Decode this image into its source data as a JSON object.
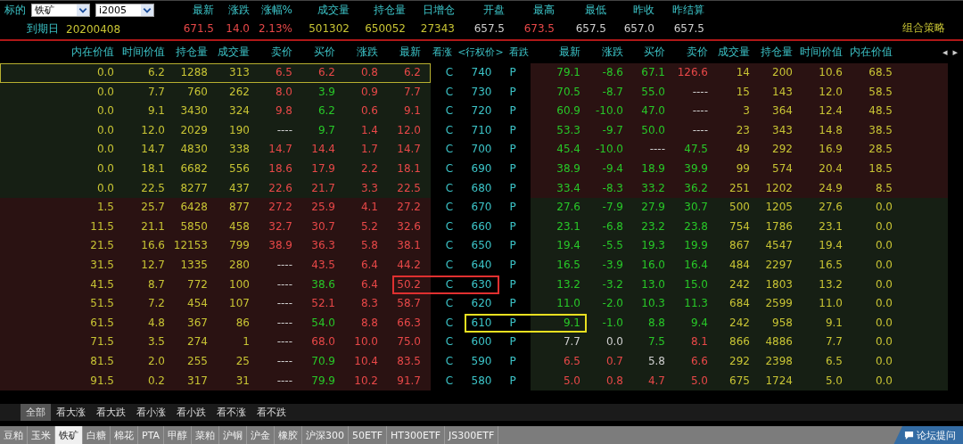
{
  "underlying": {
    "label": "标的",
    "product": "铁矿",
    "contract": "i2005"
  },
  "expiry": {
    "label": "到期日",
    "value": "20200408"
  },
  "stats": [
    {
      "label": "最新",
      "value": "671.5",
      "color": "#e84848"
    },
    {
      "label": "涨跌",
      "value": "14.0",
      "color": "#e84848"
    },
    {
      "label": "涨幅%",
      "value": "2.13%",
      "color": "#e84848"
    },
    {
      "label": "成交量",
      "value": "501302",
      "color": "#c8c434"
    },
    {
      "label": "持仓量",
      "value": "650052",
      "color": "#c8c434"
    },
    {
      "label": "日增仓",
      "value": "27343",
      "color": "#c8c434"
    },
    {
      "label": "开盘",
      "value": "657.5",
      "color": "#cfcfcf"
    },
    {
      "label": "最高",
      "value": "673.5",
      "color": "#e84848"
    },
    {
      "label": "最低",
      "value": "657.5",
      "color": "#cfcfcf"
    },
    {
      "label": "昨收",
      "value": "657.0",
      "color": "#cfcfcf"
    },
    {
      "label": "昨结算",
      "value": "657.5",
      "color": "#cfcfcf"
    }
  ],
  "strategy_link": "组合策略",
  "columns": {
    "call": [
      "内在价值",
      "时间价值",
      "持仓量",
      "成交量",
      "卖价",
      "买价",
      "涨跌",
      "最新"
    ],
    "middle": [
      "看涨",
      "<行权价>",
      "看跌"
    ],
    "put": [
      "最新",
      "涨跌",
      "买价",
      "卖价",
      "成交量",
      "持仓量",
      "时间价值",
      "内在价值"
    ],
    "scroll_arrows": [
      "◂",
      "▸"
    ]
  },
  "rows": [
    {
      "selected": true,
      "call_itm": false,
      "put_itm": true,
      "call_stats": [
        "0.0",
        "6.2",
        "1288",
        "313"
      ],
      "call_quotes": [
        {
          "text": "6.5",
          "color": "#e84848"
        },
        {
          "text": "6.2",
          "color": "#e84848"
        },
        {
          "text": "0.8",
          "color": "#e84848"
        },
        {
          "text": "6.2",
          "color": "#e84848"
        }
      ],
      "c": "C",
      "strike": "740",
      "p": "P",
      "put_quotes": [
        {
          "text": "79.1",
          "color": "#28c828"
        },
        {
          "text": "-8.6",
          "color": "#28c828"
        },
        {
          "text": "67.1",
          "color": "#28c828"
        },
        {
          "text": "126.6",
          "color": "#e84848"
        }
      ],
      "put_stats": [
        "14",
        "200",
        "10.6",
        "68.5"
      ]
    },
    {
      "selected": false,
      "call_itm": false,
      "put_itm": true,
      "call_stats": [
        "0.0",
        "7.7",
        "760",
        "262"
      ],
      "call_quotes": [
        {
          "text": "8.0",
          "color": "#e84848"
        },
        {
          "text": "3.9",
          "color": "#28c828"
        },
        {
          "text": "0.9",
          "color": "#e84848"
        },
        {
          "text": "7.7",
          "color": "#e84848"
        }
      ],
      "c": "C",
      "strike": "730",
      "p": "P",
      "put_quotes": [
        {
          "text": "70.5",
          "color": "#28c828"
        },
        {
          "text": "-8.7",
          "color": "#28c828"
        },
        {
          "text": "55.0",
          "color": "#28c828"
        },
        {
          "text": "----",
          "color": "#cfcfcf"
        }
      ],
      "put_stats": [
        "15",
        "143",
        "12.0",
        "58.5"
      ]
    },
    {
      "selected": false,
      "call_itm": false,
      "put_itm": true,
      "call_stats": [
        "0.0",
        "9.1",
        "3430",
        "324"
      ],
      "call_quotes": [
        {
          "text": "9.8",
          "color": "#e84848"
        },
        {
          "text": "6.2",
          "color": "#28c828"
        },
        {
          "text": "0.6",
          "color": "#e84848"
        },
        {
          "text": "9.1",
          "color": "#e84848"
        }
      ],
      "c": "C",
      "strike": "720",
      "p": "P",
      "put_quotes": [
        {
          "text": "60.9",
          "color": "#28c828"
        },
        {
          "text": "-10.0",
          "color": "#28c828"
        },
        {
          "text": "47.0",
          "color": "#28c828"
        },
        {
          "text": "----",
          "color": "#cfcfcf"
        }
      ],
      "put_stats": [
        "3",
        "364",
        "12.4",
        "48.5"
      ]
    },
    {
      "selected": false,
      "call_itm": false,
      "put_itm": true,
      "call_stats": [
        "0.0",
        "12.0",
        "2029",
        "190"
      ],
      "call_quotes": [
        {
          "text": "----",
          "color": "#cfcfcf"
        },
        {
          "text": "9.7",
          "color": "#28c828"
        },
        {
          "text": "1.4",
          "color": "#e84848"
        },
        {
          "text": "12.0",
          "color": "#e84848"
        }
      ],
      "c": "C",
      "strike": "710",
      "p": "P",
      "put_quotes": [
        {
          "text": "53.3",
          "color": "#28c828"
        },
        {
          "text": "-9.7",
          "color": "#28c828"
        },
        {
          "text": "50.0",
          "color": "#28c828"
        },
        {
          "text": "----",
          "color": "#cfcfcf"
        }
      ],
      "put_stats": [
        "23",
        "343",
        "14.8",
        "38.5"
      ]
    },
    {
      "selected": false,
      "call_itm": false,
      "put_itm": true,
      "call_stats": [
        "0.0",
        "14.7",
        "4830",
        "338"
      ],
      "call_quotes": [
        {
          "text": "14.7",
          "color": "#e84848"
        },
        {
          "text": "14.4",
          "color": "#e84848"
        },
        {
          "text": "1.7",
          "color": "#e84848"
        },
        {
          "text": "14.7",
          "color": "#e84848"
        }
      ],
      "c": "C",
      "strike": "700",
      "p": "P",
      "put_quotes": [
        {
          "text": "45.4",
          "color": "#28c828"
        },
        {
          "text": "-10.0",
          "color": "#28c828"
        },
        {
          "text": "----",
          "color": "#cfcfcf"
        },
        {
          "text": "47.5",
          "color": "#28c828"
        }
      ],
      "put_stats": [
        "49",
        "292",
        "16.9",
        "28.5"
      ]
    },
    {
      "selected": false,
      "call_itm": false,
      "put_itm": true,
      "call_stats": [
        "0.0",
        "18.1",
        "6682",
        "556"
      ],
      "call_quotes": [
        {
          "text": "18.6",
          "color": "#e84848"
        },
        {
          "text": "17.9",
          "color": "#e84848"
        },
        {
          "text": "2.2",
          "color": "#e84848"
        },
        {
          "text": "18.1",
          "color": "#e84848"
        }
      ],
      "c": "C",
      "strike": "690",
      "p": "P",
      "put_quotes": [
        {
          "text": "38.9",
          "color": "#28c828"
        },
        {
          "text": "-9.4",
          "color": "#28c828"
        },
        {
          "text": "18.9",
          "color": "#28c828"
        },
        {
          "text": "39.9",
          "color": "#28c828"
        }
      ],
      "put_stats": [
        "99",
        "574",
        "20.4",
        "18.5"
      ]
    },
    {
      "selected": false,
      "call_itm": false,
      "put_itm": true,
      "call_stats": [
        "0.0",
        "22.5",
        "8277",
        "437"
      ],
      "call_quotes": [
        {
          "text": "22.6",
          "color": "#e84848"
        },
        {
          "text": "21.7",
          "color": "#e84848"
        },
        {
          "text": "3.3",
          "color": "#e84848"
        },
        {
          "text": "22.5",
          "color": "#e84848"
        }
      ],
      "c": "C",
      "strike": "680",
      "p": "P",
      "put_quotes": [
        {
          "text": "33.4",
          "color": "#28c828"
        },
        {
          "text": "-8.3",
          "color": "#28c828"
        },
        {
          "text": "33.2",
          "color": "#28c828"
        },
        {
          "text": "36.2",
          "color": "#28c828"
        }
      ],
      "put_stats": [
        "251",
        "1202",
        "24.9",
        "8.5"
      ]
    },
    {
      "selected": false,
      "call_itm": true,
      "put_itm": false,
      "call_stats": [
        "1.5",
        "25.7",
        "6428",
        "877"
      ],
      "call_quotes": [
        {
          "text": "27.2",
          "color": "#e84848"
        },
        {
          "text": "25.9",
          "color": "#e84848"
        },
        {
          "text": "4.1",
          "color": "#e84848"
        },
        {
          "text": "27.2",
          "color": "#e84848"
        }
      ],
      "c": "C",
      "strike": "670",
      "p": "P",
      "put_quotes": [
        {
          "text": "27.6",
          "color": "#28c828"
        },
        {
          "text": "-7.9",
          "color": "#28c828"
        },
        {
          "text": "27.9",
          "color": "#28c828"
        },
        {
          "text": "30.7",
          "color": "#28c828"
        }
      ],
      "put_stats": [
        "500",
        "1205",
        "27.6",
        "0.0"
      ]
    },
    {
      "selected": false,
      "call_itm": true,
      "put_itm": false,
      "call_stats": [
        "11.5",
        "21.1",
        "5850",
        "458"
      ],
      "call_quotes": [
        {
          "text": "32.7",
          "color": "#e84848"
        },
        {
          "text": "30.7",
          "color": "#e84848"
        },
        {
          "text": "5.2",
          "color": "#e84848"
        },
        {
          "text": "32.6",
          "color": "#e84848"
        }
      ],
      "c": "C",
      "strike": "660",
      "p": "P",
      "put_quotes": [
        {
          "text": "23.1",
          "color": "#28c828"
        },
        {
          "text": "-6.8",
          "color": "#28c828"
        },
        {
          "text": "23.2",
          "color": "#28c828"
        },
        {
          "text": "23.8",
          "color": "#28c828"
        }
      ],
      "put_stats": [
        "754",
        "1786",
        "23.1",
        "0.0"
      ]
    },
    {
      "selected": false,
      "call_itm": true,
      "put_itm": false,
      "call_stats": [
        "21.5",
        "16.6",
        "12153",
        "799"
      ],
      "call_quotes": [
        {
          "text": "38.9",
          "color": "#e84848"
        },
        {
          "text": "36.3",
          "color": "#e84848"
        },
        {
          "text": "5.8",
          "color": "#e84848"
        },
        {
          "text": "38.1",
          "color": "#e84848"
        }
      ],
      "c": "C",
      "strike": "650",
      "p": "P",
      "put_quotes": [
        {
          "text": "19.4",
          "color": "#28c828"
        },
        {
          "text": "-5.5",
          "color": "#28c828"
        },
        {
          "text": "19.3",
          "color": "#28c828"
        },
        {
          "text": "19.9",
          "color": "#28c828"
        }
      ],
      "put_stats": [
        "867",
        "4547",
        "19.4",
        "0.0"
      ]
    },
    {
      "selected": false,
      "call_itm": true,
      "put_itm": false,
      "call_stats": [
        "31.5",
        "12.7",
        "1335",
        "280"
      ],
      "call_quotes": [
        {
          "text": "----",
          "color": "#cfcfcf"
        },
        {
          "text": "43.5",
          "color": "#e84848"
        },
        {
          "text": "6.4",
          "color": "#e84848"
        },
        {
          "text": "44.2",
          "color": "#e84848"
        }
      ],
      "c": "C",
      "strike": "640",
      "p": "P",
      "put_quotes": [
        {
          "text": "16.5",
          "color": "#28c828"
        },
        {
          "text": "-3.9",
          "color": "#28c828"
        },
        {
          "text": "16.0",
          "color": "#28c828"
        },
        {
          "text": "16.4",
          "color": "#28c828"
        }
      ],
      "put_stats": [
        "484",
        "2297",
        "16.5",
        "0.0"
      ]
    },
    {
      "selected": false,
      "call_itm": true,
      "put_itm": false,
      "box": {
        "kind": "call",
        "color": "#e03030"
      },
      "call_stats": [
        "41.5",
        "8.7",
        "772",
        "100"
      ],
      "call_quotes": [
        {
          "text": "----",
          "color": "#cfcfcf"
        },
        {
          "text": "38.6",
          "color": "#28c828"
        },
        {
          "text": "6.4",
          "color": "#e84848"
        },
        {
          "text": "50.2",
          "color": "#e84848"
        }
      ],
      "c": "C",
      "strike": "630",
      "p": "P",
      "put_quotes": [
        {
          "text": "13.2",
          "color": "#28c828"
        },
        {
          "text": "-3.2",
          "color": "#28c828"
        },
        {
          "text": "13.0",
          "color": "#28c828"
        },
        {
          "text": "15.0",
          "color": "#28c828"
        }
      ],
      "put_stats": [
        "242",
        "1803",
        "13.2",
        "0.0"
      ]
    },
    {
      "selected": false,
      "call_itm": true,
      "put_itm": false,
      "call_stats": [
        "51.5",
        "7.2",
        "454",
        "107"
      ],
      "call_quotes": [
        {
          "text": "----",
          "color": "#cfcfcf"
        },
        {
          "text": "52.1",
          "color": "#e84848"
        },
        {
          "text": "8.3",
          "color": "#e84848"
        },
        {
          "text": "58.7",
          "color": "#e84848"
        }
      ],
      "c": "C",
      "strike": "620",
      "p": "P",
      "put_quotes": [
        {
          "text": "11.0",
          "color": "#28c828"
        },
        {
          "text": "-2.0",
          "color": "#28c828"
        },
        {
          "text": "10.3",
          "color": "#28c828"
        },
        {
          "text": "11.3",
          "color": "#28c828"
        }
      ],
      "put_stats": [
        "684",
        "2599",
        "11.0",
        "0.0"
      ]
    },
    {
      "selected": false,
      "call_itm": true,
      "put_itm": false,
      "box": {
        "kind": "put",
        "color": "#e8e020"
      },
      "call_stats": [
        "61.5",
        "4.8",
        "367",
        "86"
      ],
      "call_quotes": [
        {
          "text": "----",
          "color": "#cfcfcf"
        },
        {
          "text": "54.0",
          "color": "#28c828"
        },
        {
          "text": "8.8",
          "color": "#e84848"
        },
        {
          "text": "66.3",
          "color": "#e84848"
        }
      ],
      "c": "C",
      "strike": "610",
      "p": "P",
      "put_quotes": [
        {
          "text": "9.1",
          "color": "#28c828"
        },
        {
          "text": "-1.0",
          "color": "#28c828"
        },
        {
          "text": "8.8",
          "color": "#28c828"
        },
        {
          "text": "9.4",
          "color": "#28c828"
        }
      ],
      "put_stats": [
        "242",
        "958",
        "9.1",
        "0.0"
      ]
    },
    {
      "selected": false,
      "call_itm": true,
      "put_itm": false,
      "call_stats": [
        "71.5",
        "3.5",
        "274",
        "1"
      ],
      "call_quotes": [
        {
          "text": "----",
          "color": "#cfcfcf"
        },
        {
          "text": "68.0",
          "color": "#e84848"
        },
        {
          "text": "10.0",
          "color": "#e84848"
        },
        {
          "text": "75.0",
          "color": "#e84848"
        }
      ],
      "c": "C",
      "strike": "600",
      "p": "P",
      "put_quotes": [
        {
          "text": "7.7",
          "color": "#cfcfcf"
        },
        {
          "text": "0.0",
          "color": "#cfcfcf"
        },
        {
          "text": "7.5",
          "color": "#28c828"
        },
        {
          "text": "8.1",
          "color": "#e84848"
        }
      ],
      "put_stats": [
        "866",
        "4886",
        "7.7",
        "0.0"
      ]
    },
    {
      "selected": false,
      "call_itm": true,
      "put_itm": false,
      "call_stats": [
        "81.5",
        "2.0",
        "255",
        "25"
      ],
      "call_quotes": [
        {
          "text": "----",
          "color": "#cfcfcf"
        },
        {
          "text": "70.9",
          "color": "#28c828"
        },
        {
          "text": "10.4",
          "color": "#e84848"
        },
        {
          "text": "83.5",
          "color": "#e84848"
        }
      ],
      "c": "C",
      "strike": "590",
      "p": "P",
      "put_quotes": [
        {
          "text": "6.5",
          "color": "#e84848"
        },
        {
          "text": "0.7",
          "color": "#e84848"
        },
        {
          "text": "5.8",
          "color": "#cfcfcf"
        },
        {
          "text": "6.6",
          "color": "#e84848"
        }
      ],
      "put_stats": [
        "292",
        "2398",
        "6.5",
        "0.0"
      ]
    },
    {
      "selected": false,
      "call_itm": true,
      "put_itm": false,
      "call_stats": [
        "91.5",
        "0.2",
        "317",
        "31"
      ],
      "call_quotes": [
        {
          "text": "----",
          "color": "#cfcfcf"
        },
        {
          "text": "79.9",
          "color": "#28c828"
        },
        {
          "text": "10.2",
          "color": "#e84848"
        },
        {
          "text": "91.7",
          "color": "#e84848"
        }
      ],
      "c": "C",
      "strike": "580",
      "p": "P",
      "put_quotes": [
        {
          "text": "5.0",
          "color": "#e84848"
        },
        {
          "text": "0.8",
          "color": "#e84848"
        },
        {
          "text": "4.7",
          "color": "#e84848"
        },
        {
          "text": "5.0",
          "color": "#e84848"
        }
      ],
      "put_stats": [
        "675",
        "1724",
        "5.0",
        "0.0"
      ]
    }
  ],
  "filter_tabs": [
    {
      "label": "全部",
      "selected": true
    },
    {
      "label": "看大涨",
      "selected": false
    },
    {
      "label": "看大跌",
      "selected": false
    },
    {
      "label": "看小涨",
      "selected": false
    },
    {
      "label": "看小跌",
      "selected": false
    },
    {
      "label": "看不涨",
      "selected": false
    },
    {
      "label": "看不跌",
      "selected": false
    }
  ],
  "product_tabs": [
    {
      "label": "豆粕",
      "selected": false
    },
    {
      "label": "玉米",
      "selected": false
    },
    {
      "label": "铁矿",
      "selected": true
    },
    {
      "label": "白糖",
      "selected": false
    },
    {
      "label": "棉花",
      "selected": false
    },
    {
      "label": "PTA",
      "selected": false
    },
    {
      "label": "甲醇",
      "selected": false
    },
    {
      "label": "菜粕",
      "selected": false
    },
    {
      "label": "沪铜",
      "selected": false
    },
    {
      "label": "沪金",
      "selected": false
    },
    {
      "label": "橡胶",
      "selected": false
    },
    {
      "label": "沪深300",
      "selected": false
    },
    {
      "label": "50ETF",
      "selected": false
    },
    {
      "label": "HT300ETF",
      "selected": false
    },
    {
      "label": "JS300ETF",
      "selected": false
    }
  ],
  "forum_button": {
    "label": "论坛提问"
  }
}
